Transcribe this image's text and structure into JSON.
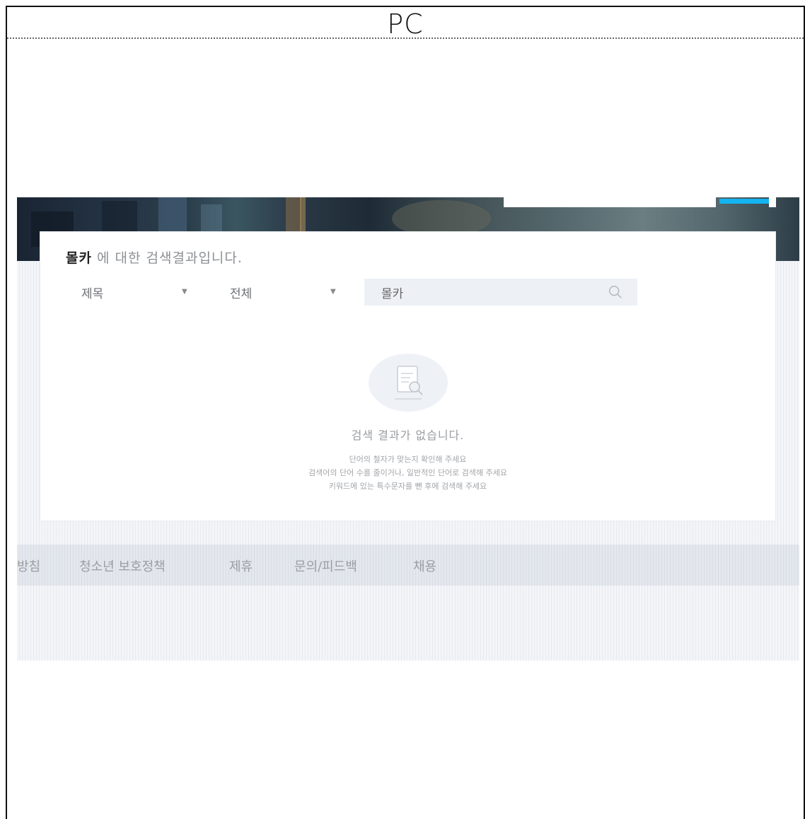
{
  "frame": {
    "title": "PC"
  },
  "search": {
    "keyword": "몰카",
    "heading_suffix": " 에 대한 검색결과입니다.",
    "filter_field": {
      "selected": "제목"
    },
    "filter_scope": {
      "selected": "전체"
    },
    "input_value": "몰카"
  },
  "empty_state": {
    "title": "검색 결과가 없습니다.",
    "tips": [
      "단어의 철자가 맞는지 확인해 주세요",
      "검색어의 단어 수를 줄이거나, 일반적인 단어로 검색해 주세요",
      "키워드에 있는 특수문자를 뺀 후에 검색해 주세요"
    ]
  },
  "footer": {
    "links": [
      "방침",
      "청소년 보호정책",
      "제휴",
      "문의/피드백",
      "채용"
    ]
  },
  "colors": {
    "accent": "#14b4f0",
    "banner_dark": "#1a2533"
  }
}
